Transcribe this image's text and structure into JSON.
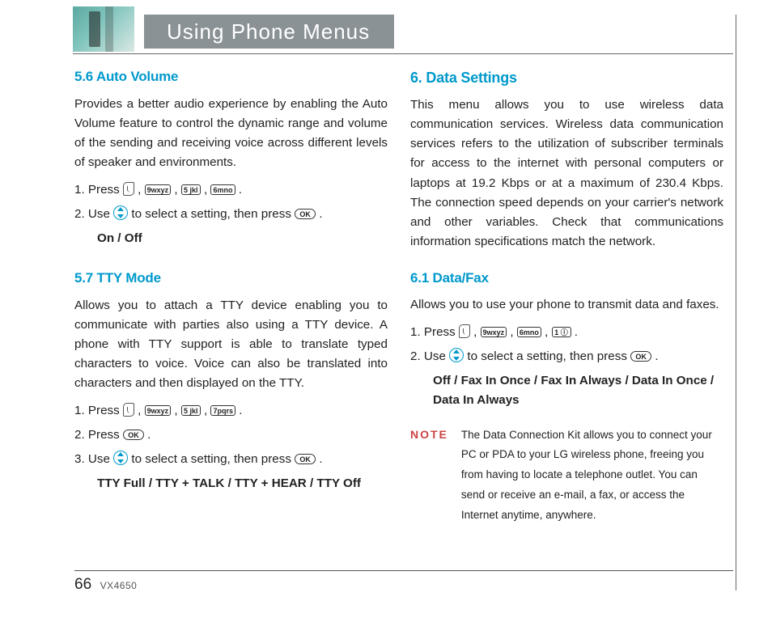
{
  "header": {
    "title": "Using Phone Menus"
  },
  "left": {
    "s56": {
      "heading": "5.6 Auto Volume",
      "para": "Provides a better audio experience by enabling the Auto Volume feature to control the dynamic range and volume of the sending and receiving voice across different levels of speaker and environments.",
      "step1_a": "1.  Press ",
      "k9": "9wxyz",
      "k5": "5 jkl",
      "k6": "6mno",
      "step2_a": "2.  Use ",
      "step2_b": " to select a setting, then press ",
      "ok": "OK",
      "options": "On / Off"
    },
    "s57": {
      "heading": "5.7 TTY Mode",
      "para": "Allows you to attach a TTY device enabling you to communicate with parties also using a TTY device. A phone with TTY support is able to translate typed characters to voice. Voice can also be translated into characters and then displayed on the TTY.",
      "step1_a": "1.  Press ",
      "k9": "9wxyz",
      "k5": "5 jkl",
      "k7": "7pqrs",
      "step2_a": "2.  Press ",
      "step3_a": "3.  Use ",
      "step3_b": " to select a setting, then press ",
      "ok": "OK",
      "options": "TTY Full / TTY + TALK / TTY + HEAR / TTY Off"
    }
  },
  "right": {
    "s6": {
      "heading": "6. Data Settings",
      "para": "This menu allows you to use wireless data communication services. Wireless data communication services refers to the utilization of subscriber terminals for access to the internet with personal computers or laptops at 19.2 Kbps or at a maximum of 230.4 Kbps. The connection speed depends on your carrier's network and other variables. Check that communications information specifications match the network."
    },
    "s61": {
      "heading": "6.1 Data/Fax",
      "para": "Allows you to use your phone to transmit data and faxes.",
      "step1_a": "1.  Press ",
      "k9": "9wxyz",
      "k6": "6mno",
      "k1": "1 ⓘ",
      "step2_a": "2.  Use ",
      "step2_b": " to select a setting, then press ",
      "ok": "OK",
      "options": "Off / Fax In Once / Fax In Always / Data In Once / Data In Always"
    },
    "note": {
      "label": "NOTE",
      "text": "The Data Connection Kit allows you to connect your PC or PDA to your LG wireless phone, freeing you from having to locate a telephone outlet. You can send or receive an e-mail, a fax, or access the Internet anytime, anywhere."
    }
  },
  "footer": {
    "page": "66",
    "model": "VX4650"
  }
}
